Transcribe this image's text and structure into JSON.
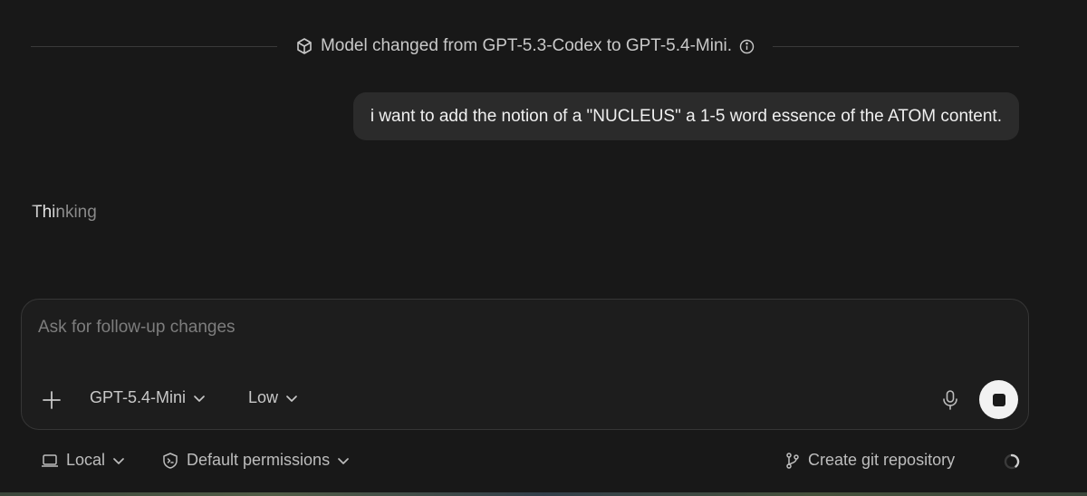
{
  "notice": {
    "text": "Model changed from GPT-5.3-Codex to GPT-5.4-Mini.",
    "icon": "cube-icon",
    "info_icon": "info-icon"
  },
  "user_message": {
    "text": "i want to add the notion of a \"NUCLEUS\" a 1-5 word essence of the ATOM content."
  },
  "status": {
    "text": "Thinking"
  },
  "composer": {
    "placeholder": "Ask for follow-up changes",
    "value": "",
    "add_icon": "plus-icon",
    "model_label": "GPT-5.4-Mini",
    "effort_label": "Low",
    "mic_icon": "microphone-icon",
    "stop_icon": "stop-icon"
  },
  "footer": {
    "environment_label": "Local",
    "permissions_label": "Default permissions",
    "git_label": "Create git repository",
    "spinner_icon": "loading-spinner-icon"
  },
  "colors": {
    "background": "#181818",
    "bubble": "#2b2b2b",
    "composer_border": "#363636",
    "stop_button": "#f2f2f2"
  }
}
